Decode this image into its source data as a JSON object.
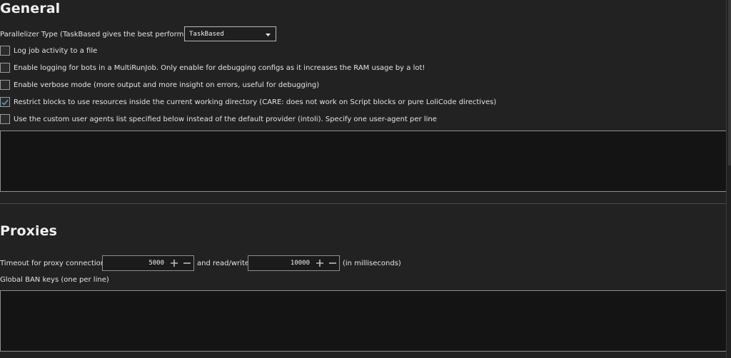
{
  "general": {
    "title": "General",
    "parallelizer_label": "Parallelizer Type (TaskBased gives the best performance)",
    "parallelizer_value": "TaskBased",
    "options": [
      {
        "label": "Log job activity to a file",
        "checked": false
      },
      {
        "label": "Enable logging for bots in a MultiRunJob. Only enable for debugging configs as it increases the RAM usage by a lot!",
        "checked": false
      },
      {
        "label": "Enable verbose mode (more output and more insight on errors, useful for debugging)",
        "checked": false
      },
      {
        "label": "Restrict blocks to use resources inside the current working directory (CARE: does not work on Script blocks or pure LoliCode directives)",
        "checked": true
      },
      {
        "label": "Use the custom user agents list specified below instead of the default provider (intoli). Specify one user-agent per line",
        "checked": false
      }
    ],
    "user_agents_text": ""
  },
  "proxies": {
    "title": "Proxies",
    "timeout_label": "Timeout for proxy connections",
    "timeout_value": "5000",
    "readwrite_label": "and read/write",
    "readwrite_value": "10000",
    "unit_label": "(in milliseconds)",
    "ban_keys_label": "Global BAN keys (one per line)",
    "ban_keys_text": ""
  },
  "colors": {
    "background": "#222222",
    "checkmark": "#4a9ee0",
    "text": "#e4e4e4"
  },
  "icons": {
    "dropdown": "chevron-down-icon",
    "increment": "plus-icon",
    "decrement": "minus-icon",
    "check": "check-icon"
  }
}
